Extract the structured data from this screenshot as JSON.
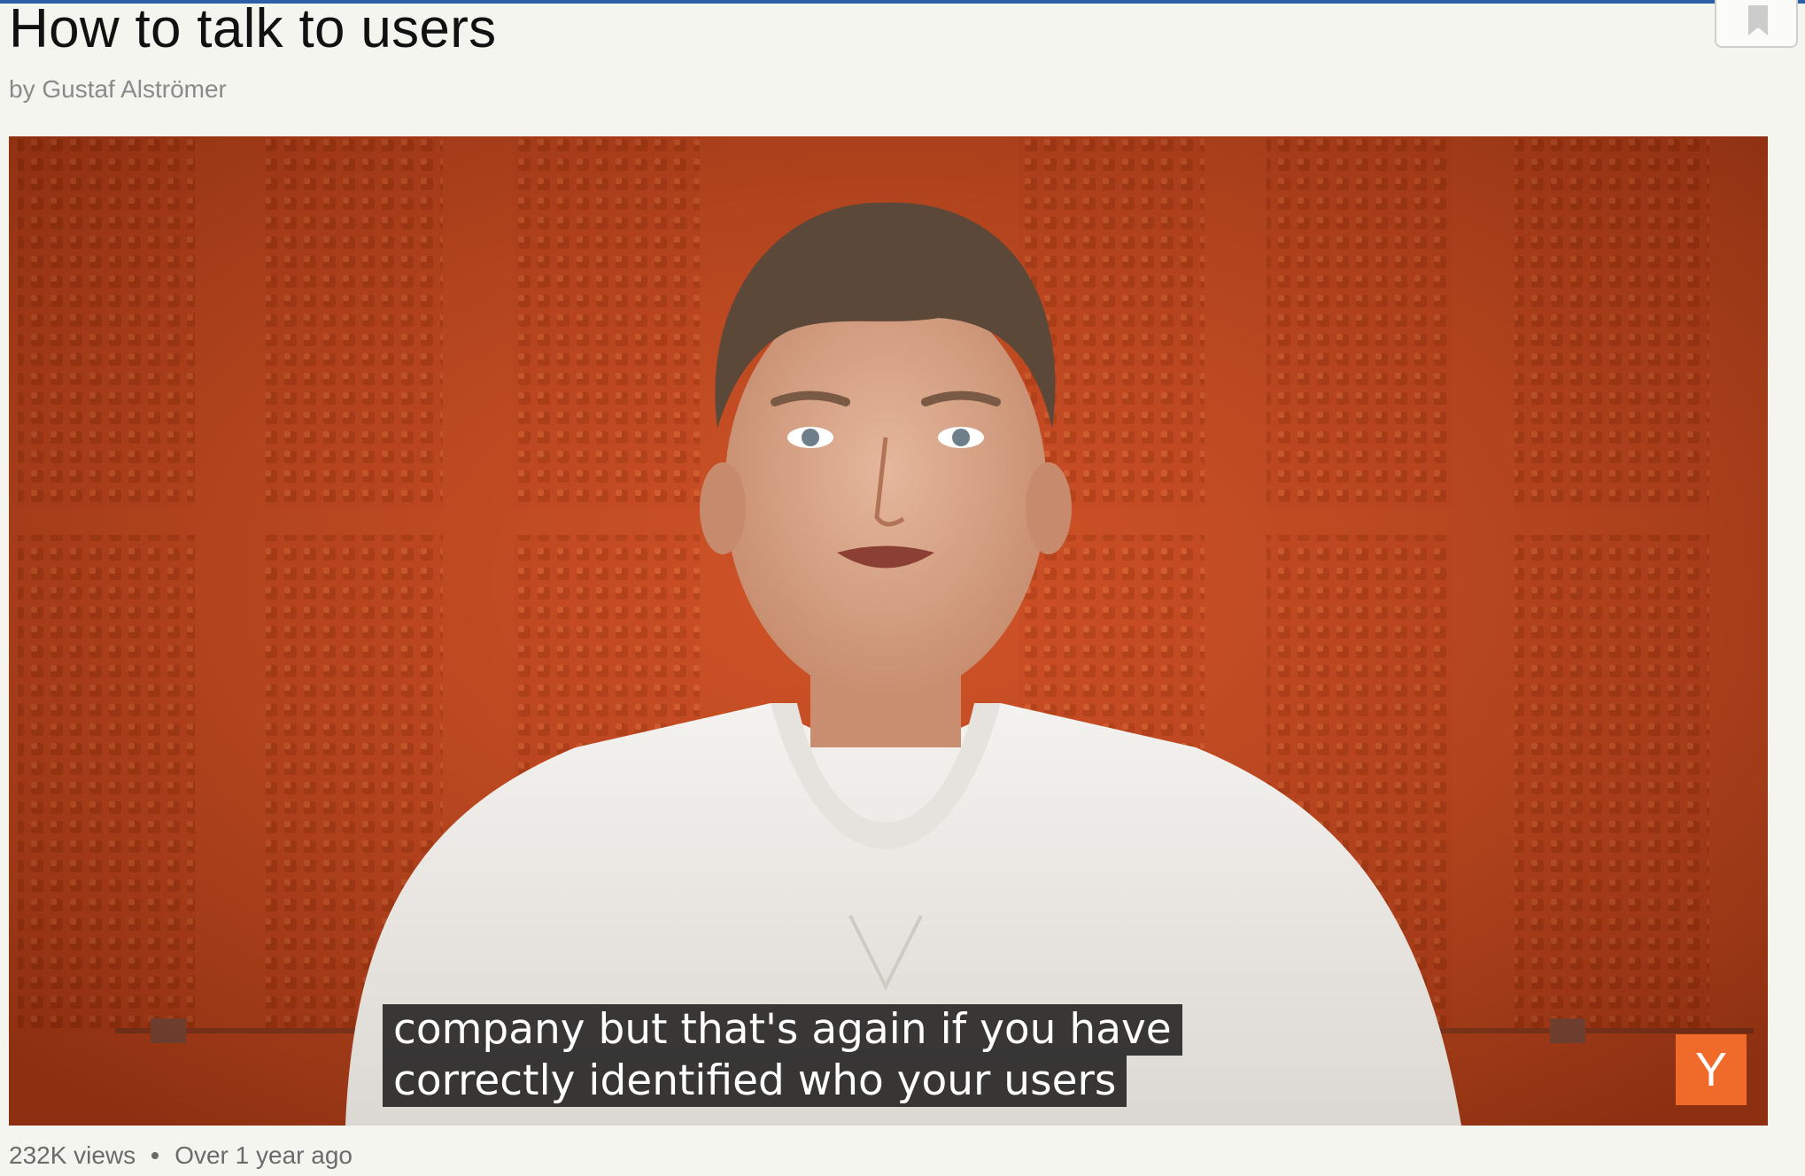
{
  "video": {
    "title": "How to talk to users",
    "author": "by Gustaf Alströmer",
    "captions": [
      "company but that's again if you have",
      "correctly identified who your users"
    ],
    "badge_letter": "Y",
    "views": "232K views",
    "age": "Over 1 year ago"
  },
  "icons": {
    "bookmark": "bookmark-icon"
  },
  "colors": {
    "top_rule": "#2d5fa8",
    "video_background": "#c84a1e",
    "badge": "#f06a2a",
    "caption_background": "#141414"
  }
}
